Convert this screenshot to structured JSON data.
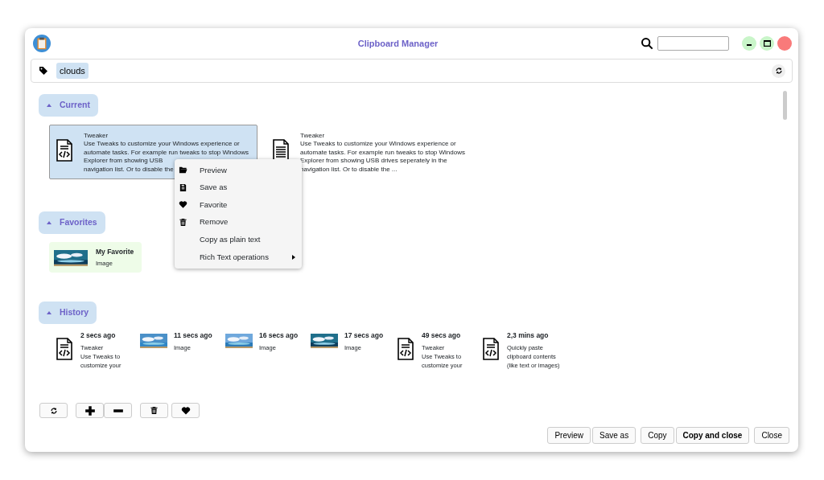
{
  "window": {
    "title": "Clipboard Manager"
  },
  "tags": [
    {
      "label": "clouds",
      "selected": true
    }
  ],
  "sections": [
    {
      "title": "Current",
      "expanded": true,
      "items": [
        {
          "kind": "code",
          "selected": true,
          "title": "Tweaker",
          "lines": [
            "Use Tweaks to customize your Windows experience or",
            "automate tasks. For example run tweaks to stop Windows",
            "Explorer from showing USB",
            "navigation list. Or to disable the"
          ]
        },
        {
          "kind": "text",
          "selected": false,
          "title": "Tweaker",
          "lines": [
            "Use Tweaks to customize your Windows experience or",
            "automate tasks. For example run tweaks to stop Windows",
            "Explorer from showing USB drives seperately in the",
            "navigation list. Or to disable the ..."
          ]
        }
      ]
    },
    {
      "title": "Favorites",
      "expanded": true,
      "items": [
        {
          "favorite": true,
          "title": "My Favorite",
          "lines": [
            "Image"
          ]
        }
      ]
    },
    {
      "title": "History",
      "expanded": true,
      "items": [
        {
          "kind": "code",
          "title": "2 secs ago",
          "lines": [
            "Tweaker",
            "Use Tweaks to",
            "customize your"
          ]
        },
        {
          "title": "11 secs ago",
          "lines": [
            "Image"
          ]
        },
        {
          "title": "16 secs ago",
          "lines": [
            "Image"
          ]
        },
        {
          "title": "17 secs ago",
          "lines": [
            "Image"
          ]
        },
        {
          "kind": "code",
          "title": "49 secs ago",
          "lines": [
            "Tweaker",
            "Use Tweaks to",
            "customize your"
          ]
        },
        {
          "kind": "code",
          "title": "2,3 mins ago",
          "lines": [
            "Quickly paste",
            "clipboard contents",
            "(like text or images)"
          ]
        }
      ]
    }
  ],
  "context_menu": [
    {
      "kind": "preview",
      "label": "Preview",
      "submenu": false
    },
    {
      "kind": "save",
      "label": "Save as",
      "submenu": false
    },
    {
      "kind": "favorite",
      "label": "Favorite",
      "submenu": false
    },
    {
      "kind": "remove",
      "label": "Remove",
      "submenu": false
    },
    {
      "kind": "none",
      "label": "Copy as plain text",
      "submenu": false
    },
    {
      "kind": "none",
      "label": "Rich Text operations",
      "submenu": true
    }
  ],
  "toolbar": [
    {
      "kind": "refresh"
    },
    {
      "kind": "add"
    },
    {
      "kind": "minus"
    },
    {
      "kind": "remove"
    },
    {
      "kind": "favorite"
    }
  ],
  "buttons": [
    {
      "label": "Preview",
      "default": false
    },
    {
      "label": "Save as",
      "default": false
    },
    {
      "label": "Copy",
      "default": false
    },
    {
      "label": "Copy and close",
      "default": true
    },
    {
      "label": "Close",
      "default": false
    }
  ]
}
